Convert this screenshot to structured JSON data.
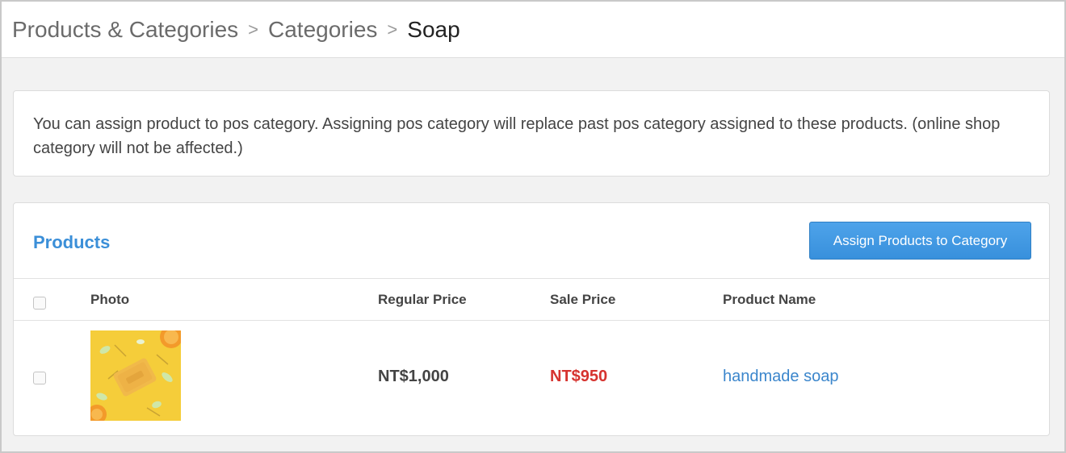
{
  "breadcrumb": {
    "items": [
      "Products & Categories",
      "Categories"
    ],
    "separator": ">",
    "current": "Soap"
  },
  "notice": {
    "text": "You can assign product to pos category. Assigning pos category will replace past pos category assigned to these products. (online shop category will not be affected.)"
  },
  "products": {
    "title": "Products",
    "assign_button_label": "Assign Products to Category",
    "columns": {
      "photo": "Photo",
      "regular_price": "Regular Price",
      "sale_price": "Sale Price",
      "product_name": "Product Name"
    },
    "rows": [
      {
        "photo": "soap-product-photo",
        "regular_price": "NT$1,000",
        "sale_price": "NT$950",
        "product_name": "handmade soap",
        "checked": false
      }
    ]
  },
  "colors": {
    "accent": "#3b8fd8",
    "button": "#3890dc",
    "sale_price": "#d6332f",
    "link": "#3b86cc"
  }
}
